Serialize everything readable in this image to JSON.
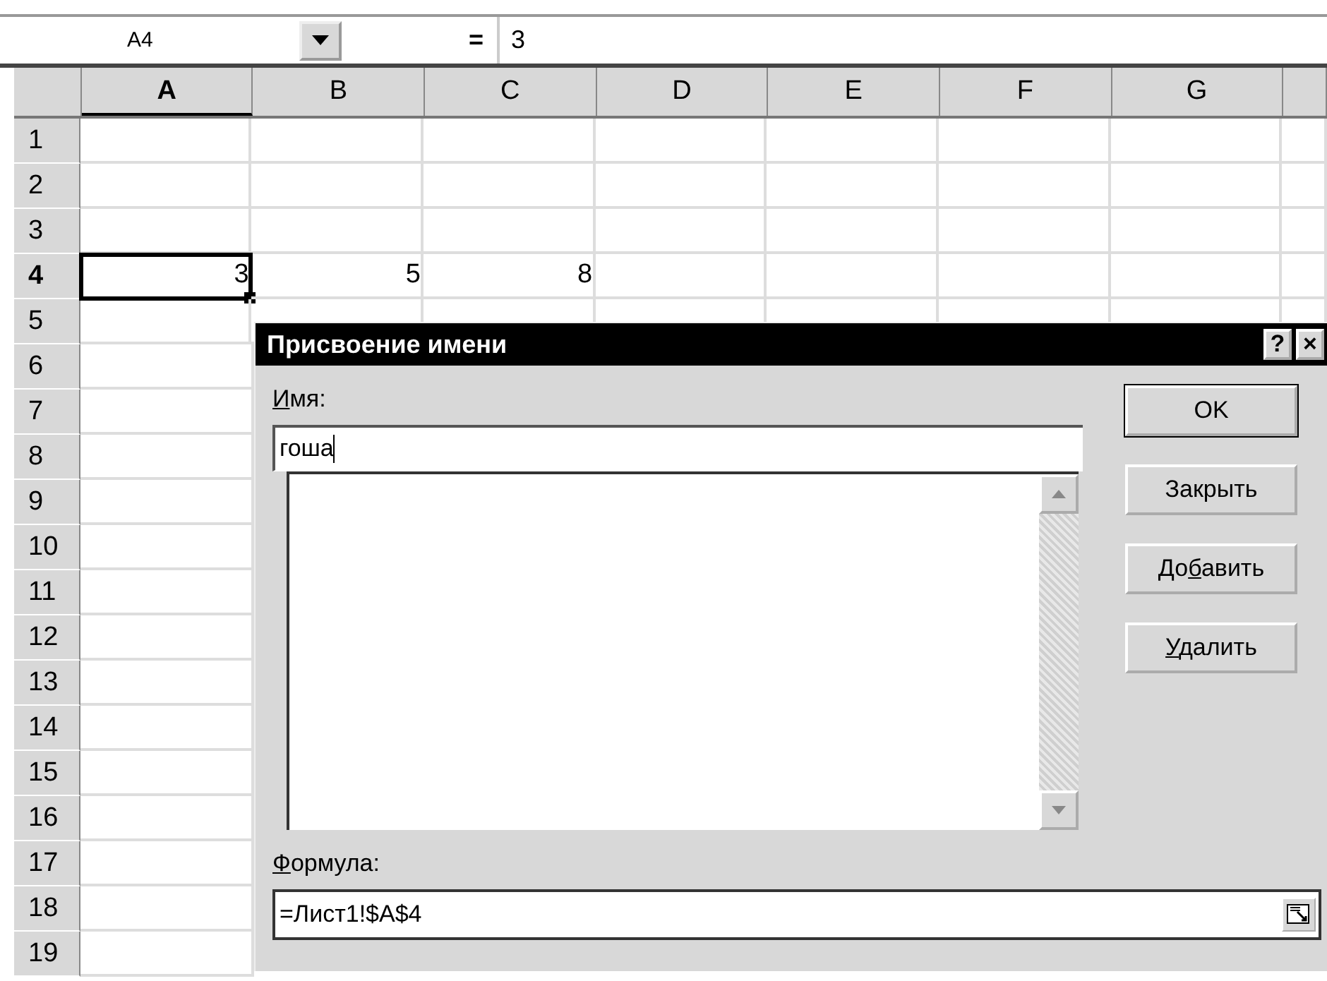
{
  "formula_bar": {
    "name_box": "A4",
    "equals": "=",
    "value": "3"
  },
  "columns": [
    {
      "label": "A",
      "selected": true
    },
    {
      "label": "B",
      "selected": false
    },
    {
      "label": "C",
      "selected": false
    },
    {
      "label": "D",
      "selected": false
    },
    {
      "label": "E",
      "selected": false
    },
    {
      "label": "F",
      "selected": false
    },
    {
      "label": "G",
      "selected": false
    }
  ],
  "rows": [
    {
      "label": "1",
      "selected": false
    },
    {
      "label": "2",
      "selected": false
    },
    {
      "label": "3",
      "selected": false
    },
    {
      "label": "4",
      "selected": true,
      "cells": [
        {
          "value": "3",
          "selected": true
        },
        {
          "value": "5",
          "selected": false
        },
        {
          "value": "8",
          "selected": false
        }
      ]
    },
    {
      "label": "5",
      "selected": false
    },
    {
      "label": "6",
      "selected": false
    },
    {
      "label": "7",
      "selected": false
    },
    {
      "label": "8",
      "selected": false
    },
    {
      "label": "9",
      "selected": false
    },
    {
      "label": "10",
      "selected": false
    },
    {
      "label": "11",
      "selected": false
    },
    {
      "label": "12",
      "selected": false
    },
    {
      "label": "13",
      "selected": false
    },
    {
      "label": "14",
      "selected": false
    },
    {
      "label": "15",
      "selected": false
    },
    {
      "label": "16",
      "selected": false
    },
    {
      "label": "17",
      "selected": false
    },
    {
      "label": "18",
      "selected": false
    },
    {
      "label": "19",
      "selected": false
    }
  ],
  "dialog": {
    "title": "Присвоение имени",
    "help": "?",
    "close": "×",
    "name_label": {
      "key": "И",
      "post": "мя:"
    },
    "name_value": "гоша",
    "formula_label": {
      "key": "Ф",
      "post": "ормула:"
    },
    "formula_value": "=Лист1!$A$4",
    "buttons": [
      {
        "label": {
          "pre": "OK"
        },
        "default": true
      },
      {
        "label": {
          "pre": "Закрыть"
        },
        "default": false
      },
      {
        "label": {
          "pre": "До",
          "key": "б",
          "post": "авить"
        },
        "default": false
      },
      {
        "label": {
          "key": "У",
          "post": "далить"
        },
        "default": false
      }
    ]
  }
}
